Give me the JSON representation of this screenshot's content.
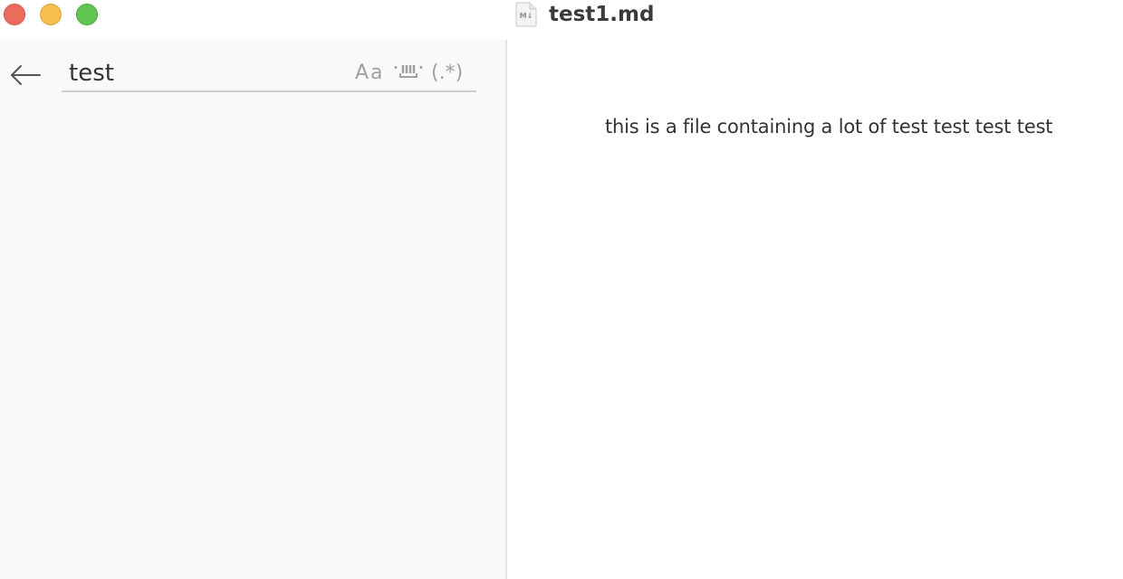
{
  "window": {
    "title": "test1.md",
    "file_icon_label": "M↓"
  },
  "traffic_lights": {
    "close_color": "#ec6a5e",
    "minimize_color": "#f4bf4f",
    "maximize_color": "#61c554"
  },
  "sidebar": {
    "back_icon": "arrow-left-icon",
    "search": {
      "value": "test",
      "placeholder": ""
    },
    "options": {
      "match_case_label": "Aa",
      "whole_word_icon": "whole-word-icon",
      "regex_label": "(.*)"
    }
  },
  "document": {
    "text": "this is a file containing a lot of test test test test"
  }
}
